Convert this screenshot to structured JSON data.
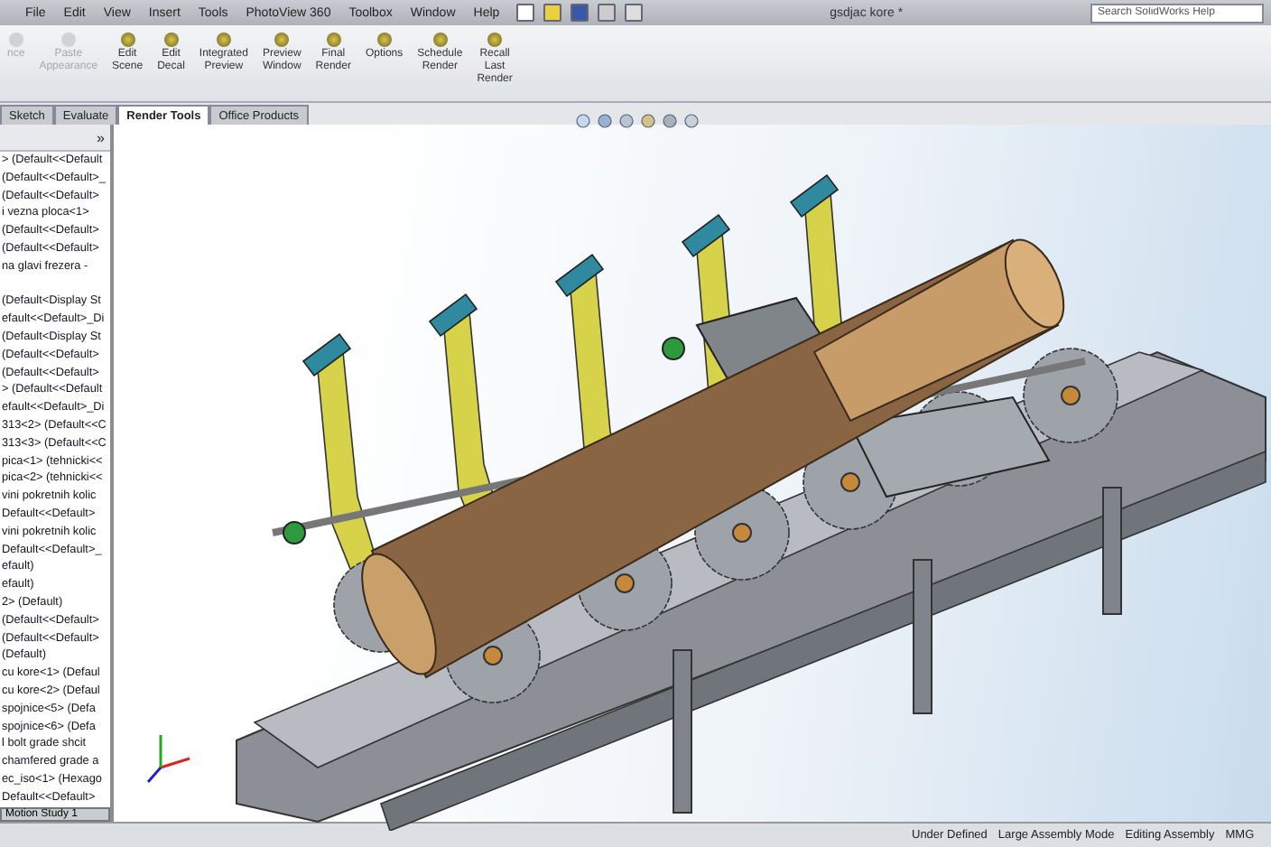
{
  "menu": [
    "File",
    "Edit",
    "View",
    "Insert",
    "Tools",
    "PhotoView 360",
    "Toolbox",
    "Window",
    "Help"
  ],
  "window": {
    "title": "gsdjac kore *"
  },
  "search": {
    "placeholder": "Search SolidWorks Help"
  },
  "ribbon": [
    {
      "lines": [
        "nce"
      ],
      "disabled": true
    },
    {
      "lines": [
        "Paste",
        "Appearance"
      ],
      "disabled": true
    },
    {
      "lines": [
        "Edit",
        "Scene"
      ],
      "disabled": false
    },
    {
      "lines": [
        "Edit",
        "Decal"
      ],
      "disabled": false
    },
    {
      "lines": [
        "Integrated",
        "Preview"
      ],
      "disabled": false
    },
    {
      "lines": [
        "Preview",
        "Window"
      ],
      "disabled": false
    },
    {
      "lines": [
        "Final",
        "Render"
      ],
      "disabled": false
    },
    {
      "lines": [
        "Options"
      ],
      "disabled": false
    },
    {
      "lines": [
        "Schedule",
        "Render"
      ],
      "disabled": false
    },
    {
      "lines": [
        "Recall",
        "Last",
        "Render"
      ],
      "disabled": false
    }
  ],
  "tabs": [
    {
      "label": "Sketch",
      "selected": false
    },
    {
      "label": "Evaluate",
      "selected": false
    },
    {
      "label": "Render Tools",
      "selected": true
    },
    {
      "label": "Office Products",
      "selected": false
    }
  ],
  "tree": {
    "collapse": "»",
    "items": [
      "> (Default<<Default",
      "(Default<<Default>_",
      "(Default<<Default>",
      "i vezna ploca<1>",
      "(Default<<Default>",
      "(Default<<Default>",
      "na glavi frezera -",
      "(Default<Display St",
      "efault<<Default>_Di",
      "(Default<Display St",
      "(Default<<Default>",
      "(Default<<Default>",
      "> (Default<<Default",
      "efault<<Default>_Di",
      "313<2> (Default<<C",
      "313<3> (Default<<C",
      "pica<1> (tehnicki<<",
      "pica<2> (tehnicki<<",
      "vini pokretnih kolic",
      "Default<<Default>",
      "vini pokretnih kolic",
      "Default<<Default>_",
      "efault)",
      "efault)",
      "2> (Default)",
      "(Default<<Default>",
      "(Default<<Default>",
      "(Default)",
      "cu kore<1> (Defaul",
      "cu kore<2> (Defaul",
      "spojnice<5> (Defa",
      "spojnice<6> (Defa",
      "l bolt grade shcit",
      "chamfered grade a",
      "ec_iso<1> (Hexago",
      "Default<<Default>"
    ]
  },
  "bottom_tab": "Motion Study 1",
  "status_bar": [
    "Under Defined",
    "Large Assembly Mode",
    "Editing Assembly",
    "MMG"
  ]
}
